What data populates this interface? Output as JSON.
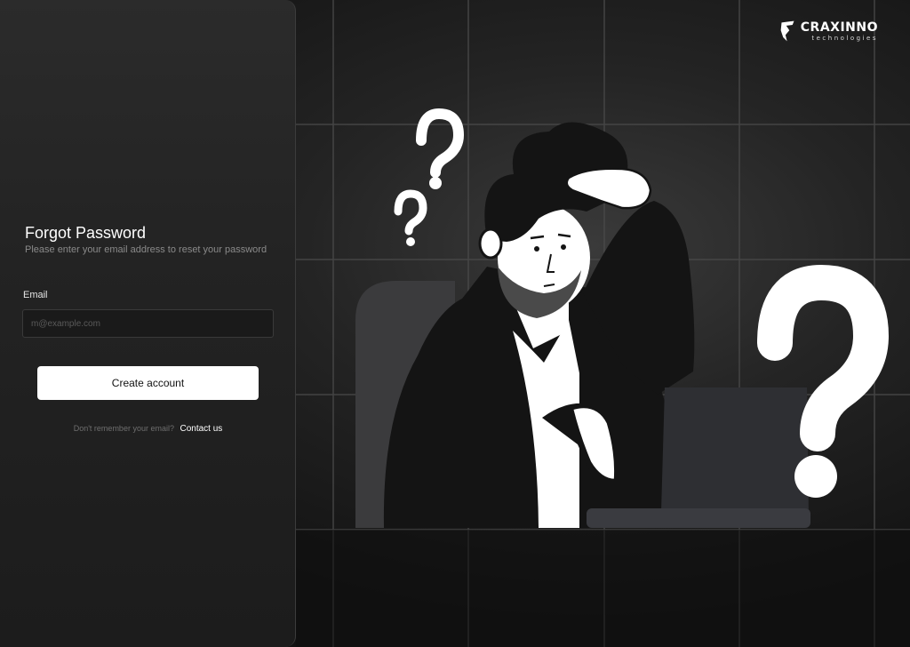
{
  "brand": {
    "name": "CRAXINNO",
    "tagline": "technologies"
  },
  "form": {
    "title": "Forgot Password",
    "subtitle": "Please enter your email address to reset your password",
    "email_label": "Email",
    "email_placeholder": "m@example.com",
    "email_value": "",
    "submit_label": "Create account",
    "help_text": "Don't remember your email?",
    "contact_label": "Contact us"
  },
  "theme": {
    "panel_background": "#262626",
    "accent": "#ffffff",
    "muted_text": "#8a8a8a"
  },
  "illustration": {
    "subject": "confused-person-at-laptop",
    "icons": [
      "question-mark-icon",
      "question-mark-icon",
      "question-mark-icon"
    ]
  }
}
